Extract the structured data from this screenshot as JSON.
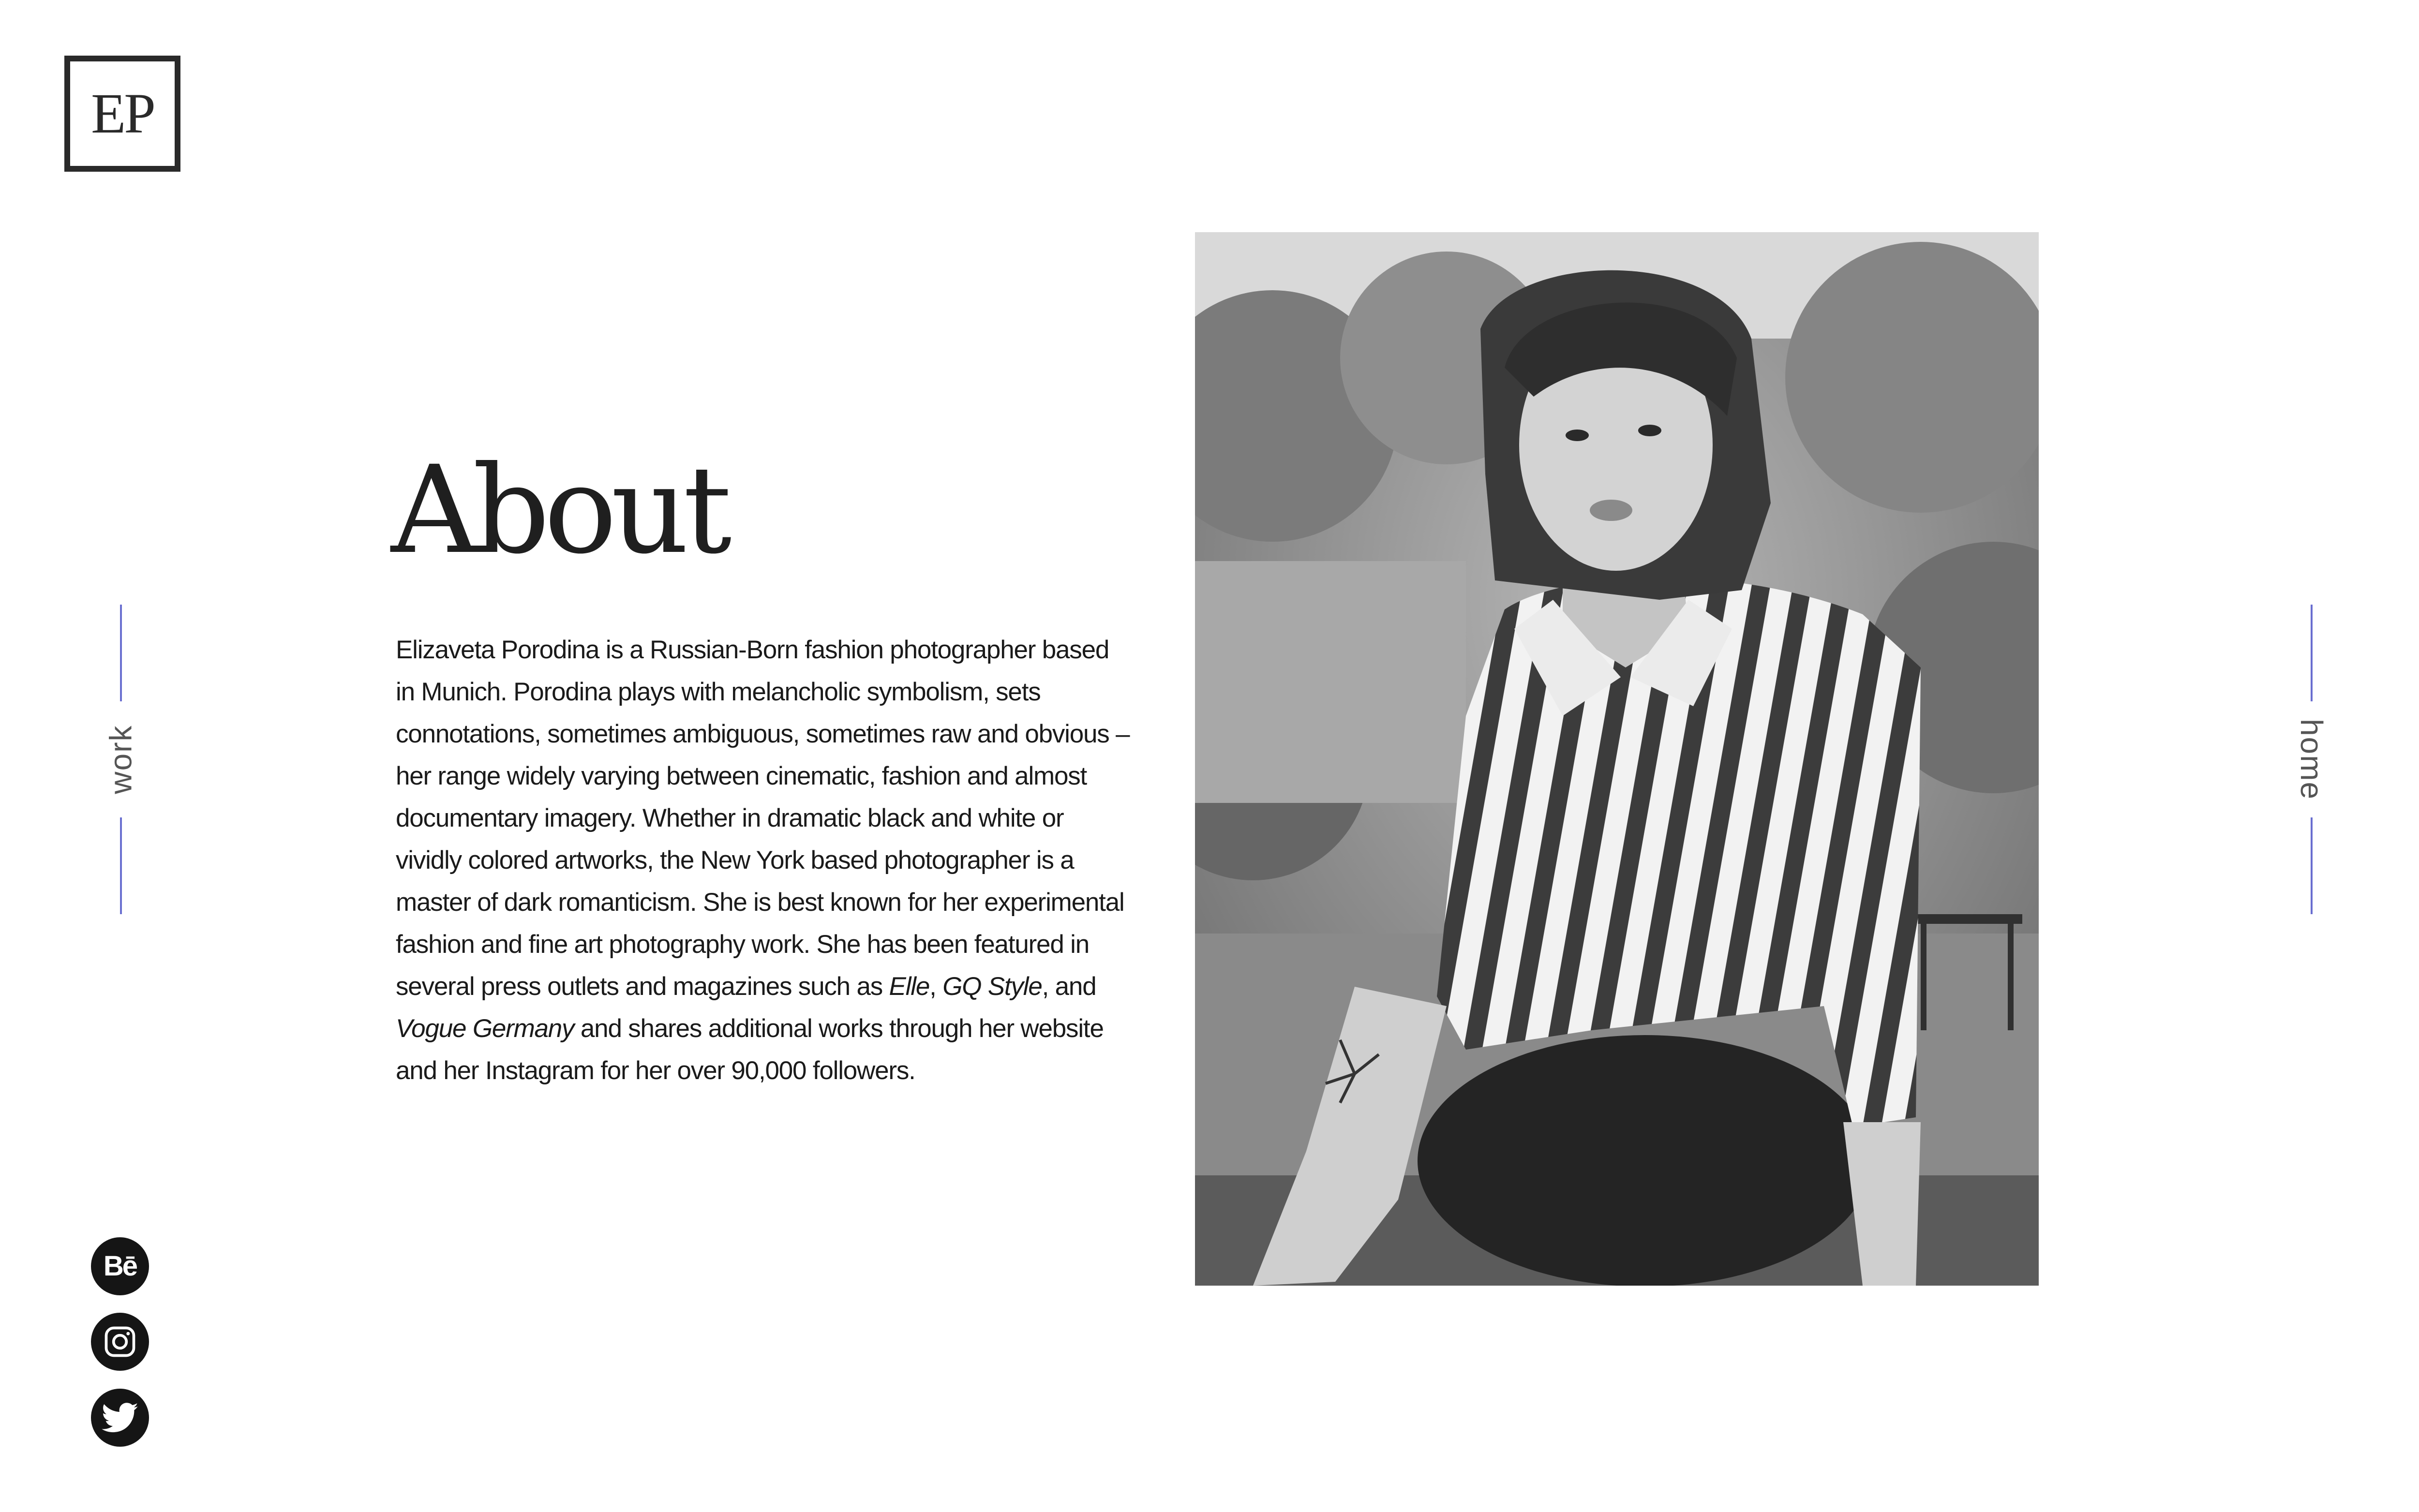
{
  "logo": {
    "text": "EP"
  },
  "nav": {
    "left_label": "work",
    "right_label": "home",
    "accent_color": "#6a6fd0"
  },
  "about": {
    "title": "About",
    "bio_part1": "Elizaveta Porodina is a Russian-Born fashion photographer based in Munich. Porodina plays with melancholic symbolism, sets connotations, sometimes ambiguous, sometimes raw and obvious – her range widely varying between cinematic, fashion and almost documentary imagery. Whether in dramatic black and white or vividly colored artworks, the New York based photographer is a master of dark romanticism. She is best known for her experimental fashion and fine art photography work. She has been featured in several press outlets and magazines such as ",
    "bio_elle": "Elle",
    "bio_sep1": ", ",
    "bio_gq": "GQ Style",
    "bio_sep2": ", and ",
    "bio_vogue": "Vogue Germany",
    "bio_part2": " and shares additional works through her website and her Instagram for her over 90,000 followers."
  },
  "social": {
    "behance_icon": "behance-icon",
    "behance_glyph": "Bē",
    "instagram_icon": "instagram-icon",
    "twitter_icon": "twitter-icon"
  }
}
